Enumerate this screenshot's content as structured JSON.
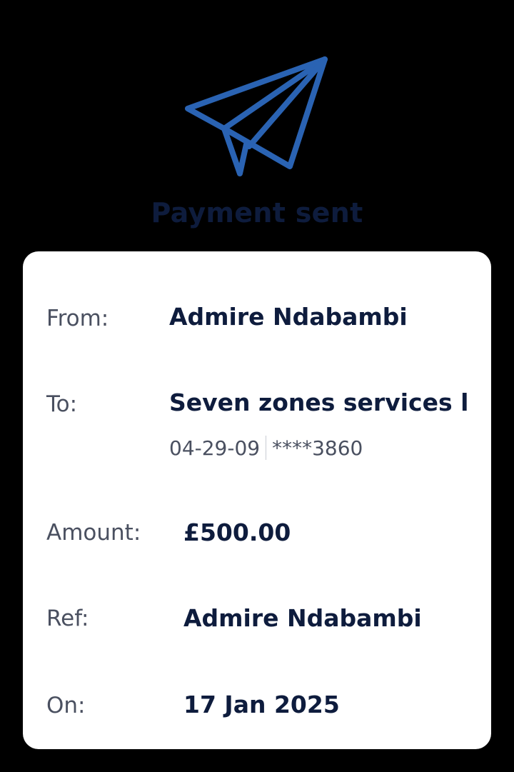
{
  "header": {
    "icon": "paper-plane-icon",
    "title": "Payment sent"
  },
  "details": {
    "from_label": "From:",
    "from_value": "Admire Ndabambi",
    "to_label": "To:",
    "to_value": "Seven zones services lin",
    "sort_code": "04-29-09",
    "account": "****3860",
    "amount_label": "Amount:",
    "amount_value": "£500.00",
    "ref_label": "Ref:",
    "ref_value": "Admire Ndabambi",
    "on_label": "On:",
    "on_value": "17 Jan 2025"
  },
  "colors": {
    "background": "#000000",
    "card": "#ffffff",
    "accent": "#2a63b3",
    "text_primary": "#0e1c3d",
    "text_secondary": "#4a5060"
  }
}
